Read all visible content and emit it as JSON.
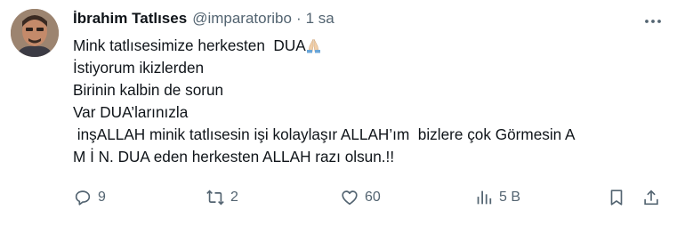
{
  "author": {
    "name": "İbrahim Tatlıses",
    "handle": "@imparatoribo",
    "separator": "·",
    "time": "1 sa"
  },
  "tweet": {
    "lines": [
      "Mink tatlısesimize herkesten  DUA",
      "İstiyorum ikizlerden",
      "Birinin kalbin de sorun",
      "Var DUA’larınızla",
      " inşALLAH minik tatlısesin işi kolaylaşır ALLAH’ım  bizlere çok Görmesin A",
      "M İ N. DUA eden herkesten ALLAH razı olsun.!!"
    ],
    "emoji": "praying-hands-icon"
  },
  "actions": {
    "replies": "9",
    "reposts": "2",
    "likes": "60",
    "views": "5 B"
  },
  "colors": {
    "text": "#0f1419",
    "secondary": "#536471"
  }
}
